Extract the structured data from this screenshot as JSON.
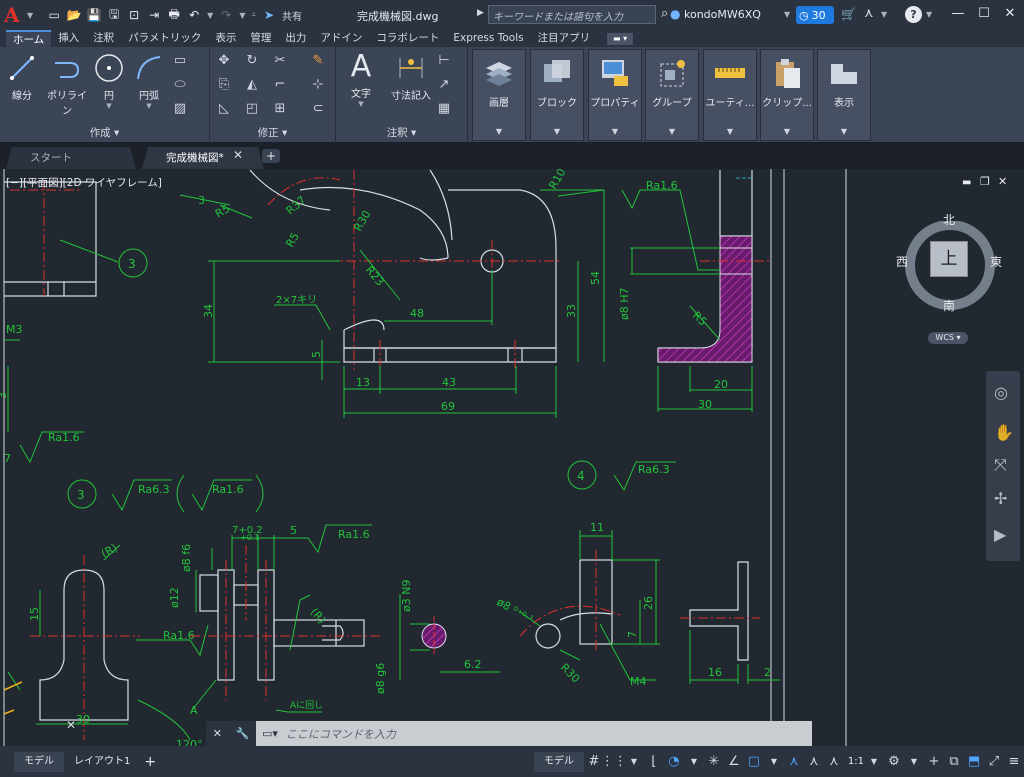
{
  "app": {
    "logo": "A",
    "doc_title": "完成機械図.dwg",
    "share_label": "共有",
    "search_placeholder": "キーワードまたは語句を入力",
    "user": "kondoMW6XQ",
    "badge_count": "30"
  },
  "ribbon_tabs": [
    "ホーム",
    "挿入",
    "注釈",
    "パラメトリック",
    "表示",
    "管理",
    "出力",
    "アドイン",
    "コラボレート",
    "Express Tools",
    "注目アプリ"
  ],
  "ribbon": {
    "draw_panel": {
      "title": "作成",
      "line": "線分",
      "polyline": "ポリライン",
      "circle": "円",
      "arc": "円弧"
    },
    "modify_panel": {
      "title": "修正"
    },
    "annotation_panel": {
      "title": "注釈",
      "text": "文字",
      "dimension": "寸法記入"
    },
    "groups": [
      "画層",
      "ブロック",
      "プロパティ",
      "グループ",
      "ユーティ...",
      "クリップ...",
      "表示"
    ]
  },
  "file_tabs": {
    "start": "スタート",
    "active": "完成機械図*"
  },
  "viewport": {
    "label": "[−][平面図][2D ワイヤフレーム]"
  },
  "viewcube": {
    "north": "北",
    "south": "南",
    "east": "東",
    "west": "西",
    "top": "上",
    "wcs": "WCS"
  },
  "drawing": {
    "dims": [
      "3",
      "R5",
      "R37",
      "R5",
      "R30",
      "R10",
      "R23",
      "Ra1.6",
      "54",
      "34",
      "48",
      "33",
      "5",
      "13",
      "43",
      "69",
      "2×7キリ",
      "ø8 H7",
      "R5",
      "20",
      "30",
      "M3",
      "Ra1.6",
      "3",
      "4",
      "Ra6.3",
      "Ra6.3",
      "Ra1.6",
      "7+0.2/+0.1",
      "5",
      "Ra1.6",
      "ø8 f6",
      "(R)",
      "ø12",
      "15",
      "Ra1.6",
      "(R)",
      "ø3 N9",
      "6.2",
      "ø8 g6",
      "A",
      "A に回し",
      "30",
      "11",
      "ø8",
      "26",
      "7",
      "R30",
      "M4",
      "16",
      "2",
      "3"
    ]
  },
  "cmdline": {
    "placeholder": "ここにコマンドを入力"
  },
  "status": {
    "model_tab": "モデル",
    "layout_tab": "レイアウト1",
    "model_btn": "モデル",
    "scale": "1:1"
  }
}
